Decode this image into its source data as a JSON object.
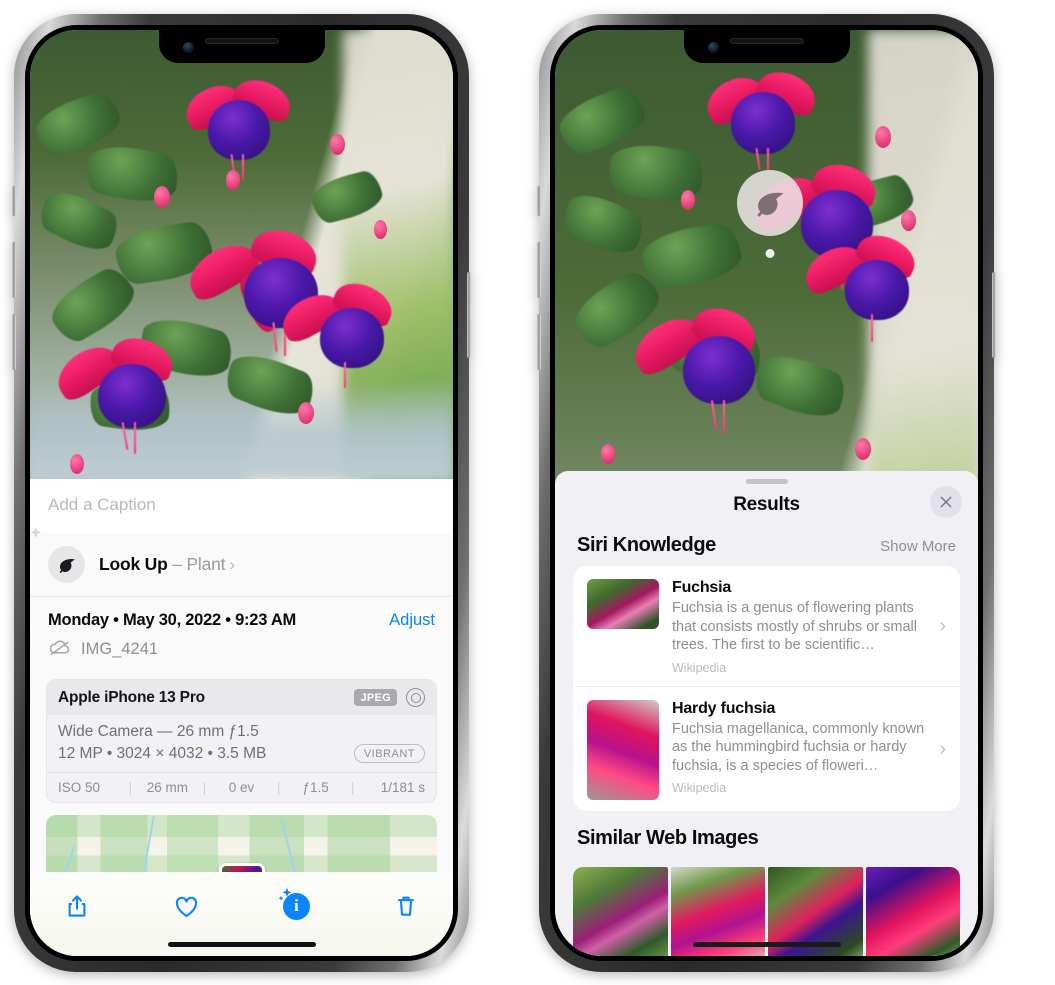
{
  "left_phone": {
    "caption_placeholder": "Add a Caption",
    "lookup": {
      "label": "Look Up",
      "dash": " – ",
      "subject": "Plant",
      "chevron": "›",
      "icon": "leaf-icon"
    },
    "meta": {
      "date": "Monday • May 30, 2022 • 9:23 AM",
      "adjust_label": "Adjust",
      "filename": "IMG_4241",
      "cloud_icon": "icloud-slash-icon"
    },
    "exif": {
      "device": "Apple iPhone 13 Pro",
      "format_badge": "JPEG",
      "lens_icon": "lens-icon",
      "lens_line": "Wide Camera — 26 mm ƒ1.5",
      "size_line": "12 MP • 3024 × 4032 • 3.5 MB",
      "style_badge": "VIBRANT",
      "stats": [
        "ISO 50",
        "26 mm",
        "0 ev",
        "ƒ1.5",
        "1/181 s"
      ],
      "separator": "|"
    },
    "map": {
      "pin_label": "photo-thumbnail-pin"
    },
    "toolbar": [
      {
        "name": "share-button",
        "icon": "share-icon"
      },
      {
        "name": "favorite-button",
        "icon": "heart-icon"
      },
      {
        "name": "info-button",
        "icon": "info-sparkle-icon",
        "glyph": "i"
      },
      {
        "name": "delete-button",
        "icon": "trash-icon"
      }
    ]
  },
  "right_phone": {
    "badge": {
      "name": "visual-lookup-badge",
      "icon": "leaf-icon"
    },
    "sheet": {
      "title": "Results",
      "close_icon": "close-icon",
      "grabber": "sheet-grabber"
    },
    "siri_knowledge": {
      "title": "Siri Knowledge",
      "action": "Show More",
      "items": [
        {
          "title": "Fuchsia",
          "description": "Fuchsia is a genus of flowering plants that consists mostly of shrubs or small trees. The first to be scientific…",
          "source": "Wikipedia",
          "chevron": "›"
        },
        {
          "title": "Hardy fuchsia",
          "description": "Fuchsia magellanica, commonly known as the hummingbird fuchsia or hardy fuchsia, is a species of floweri…",
          "source": "Wikipedia",
          "chevron": "›"
        }
      ]
    },
    "similar_web_images": {
      "title": "Similar Web Images",
      "thumbnails": [
        "web-image-1",
        "web-image-2",
        "web-image-3",
        "web-image-4"
      ]
    }
  },
  "colors": {
    "accent_blue": "#0a84ff",
    "sheet_bg": "#f1f0f5",
    "card_bg": "#ffffff",
    "secondary_text": "#8e8e93",
    "primary_text": "#0b0b0c"
  }
}
